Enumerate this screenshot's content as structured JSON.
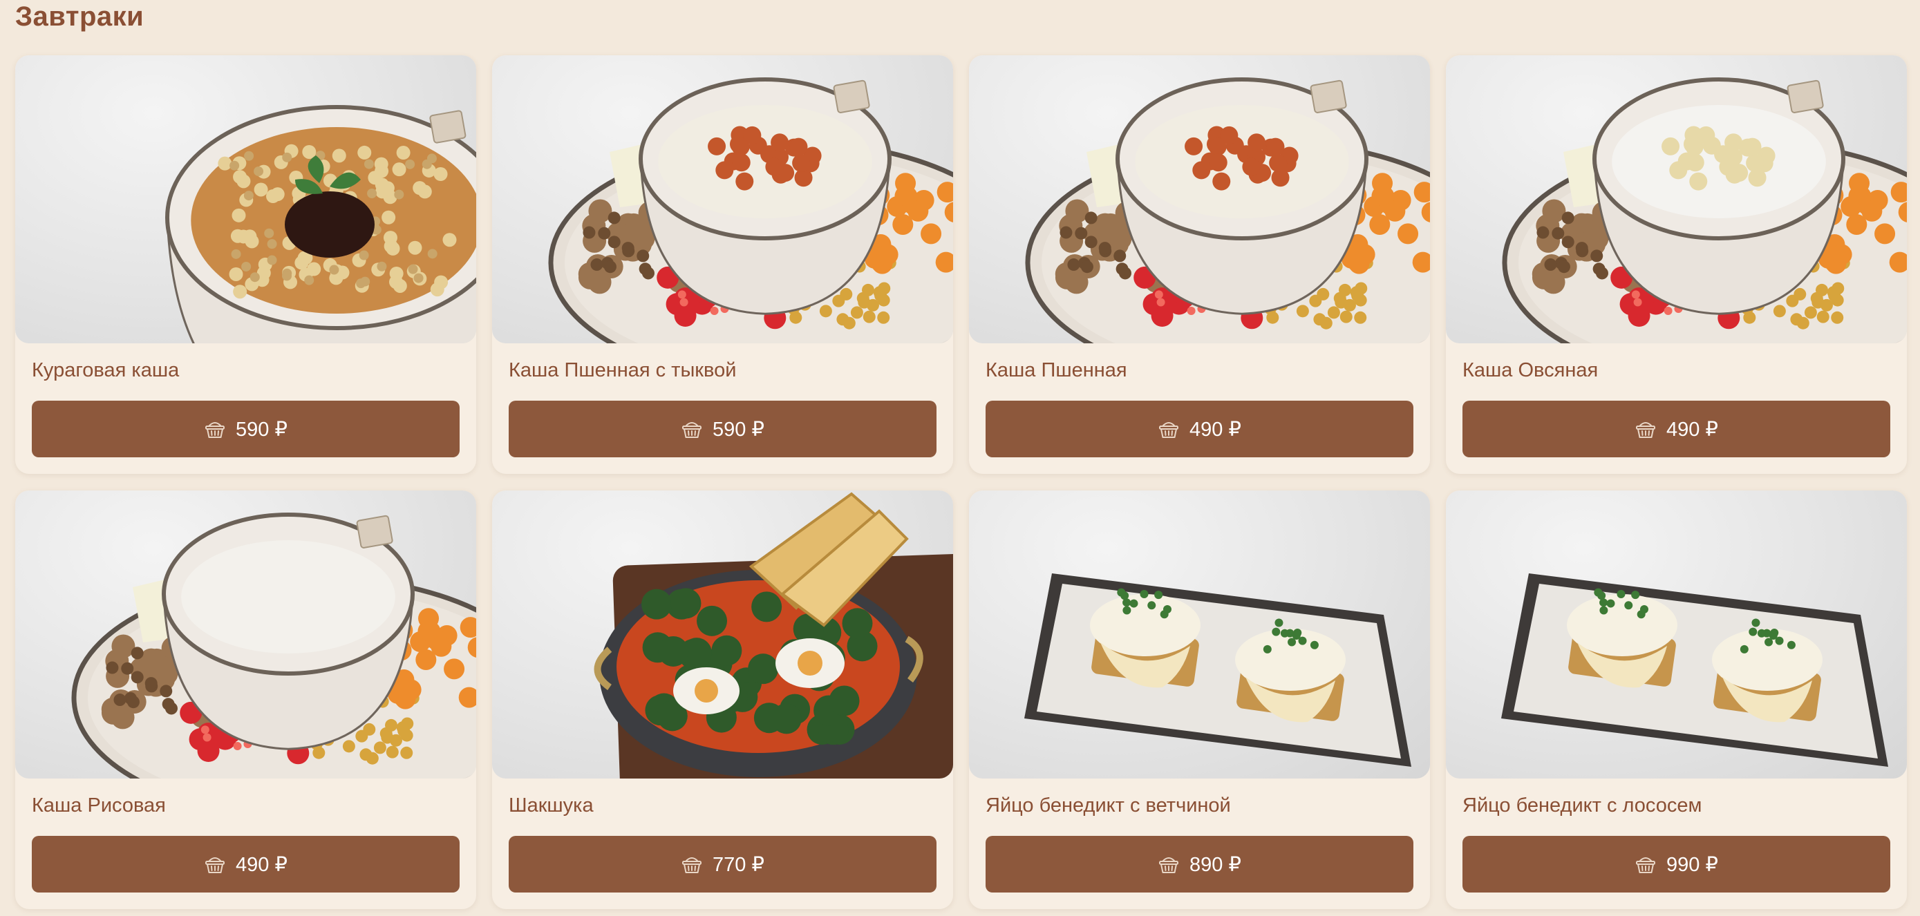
{
  "section": {
    "title": "Завтраки"
  },
  "items": [
    {
      "name": "Кураговая каша",
      "price": "590 ₽",
      "photo": "kuragovaya"
    },
    {
      "name": "Каша Пшенная с тыквой",
      "price": "590 ₽",
      "photo": "platter-pshennaya"
    },
    {
      "name": "Каша Пшенная",
      "price": "490 ₽",
      "photo": "platter-pshennaya"
    },
    {
      "name": "Каша Овсяная",
      "price": "490 ₽",
      "photo": "platter-ovsyanaya"
    },
    {
      "name": "Каша Рисовая",
      "price": "490 ₽",
      "photo": "platter-risovaya"
    },
    {
      "name": "Шакшука",
      "price": "770 ₽",
      "photo": "shakshuka"
    },
    {
      "name": "Яйцо бенедикт с ветчиной",
      "price": "890 ₽",
      "photo": "benedict"
    },
    {
      "name": "Яйцо бенедикт с лососем",
      "price": "990 ₽",
      "photo": "benedict"
    }
  ],
  "icons": {
    "button": "basket-icon"
  },
  "colors": {
    "background": "#f3e9dc",
    "card": "#f7eee3",
    "accent": "#8d583c",
    "text": "#8a4f34"
  }
}
